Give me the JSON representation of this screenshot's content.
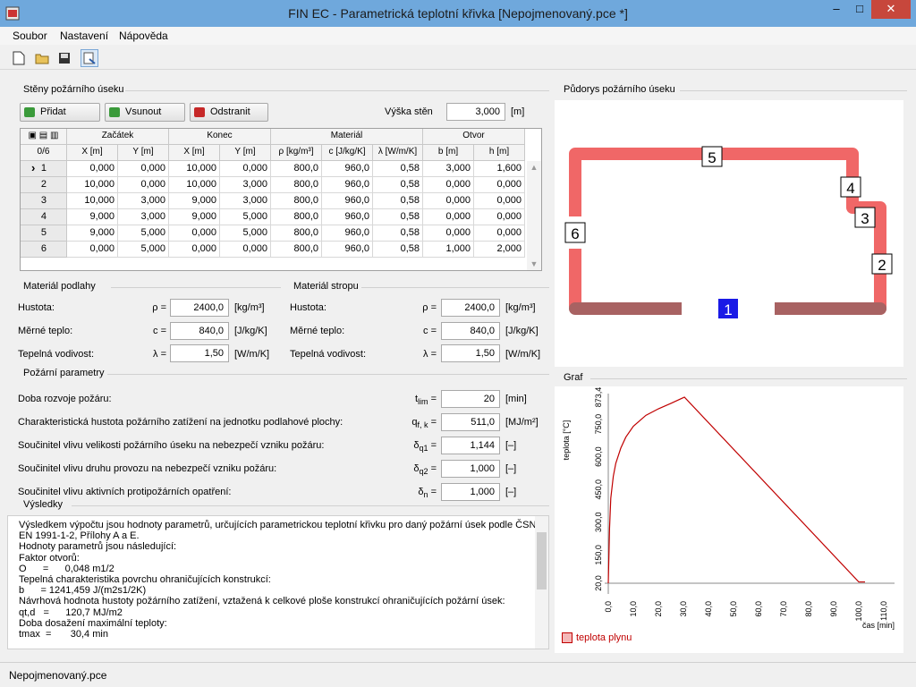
{
  "window": {
    "title": "FIN EC - Parametrická teplotní křivka [Nepojmenovaný.pce *]"
  },
  "menu": [
    "Soubor",
    "Nastavení",
    "Nápověda"
  ],
  "toolbar": {
    "icons": [
      "new-file-icon",
      "open-folder-icon",
      "save-icon",
      "report-icon"
    ]
  },
  "walls": {
    "title": "Stěny požárního úseku",
    "add": "Přidat",
    "insert": "Vsunout",
    "remove": "Odstranit",
    "height_label": "Výška stěn",
    "height_value": "3,000",
    "height_unit": "[m]",
    "count": "0/6",
    "groups": [
      "Začátek",
      "Konec",
      "Materiál",
      "Otvor"
    ],
    "columns": [
      "X [m]",
      "Y [m]",
      "X [m]",
      "Y [m]",
      "ρ [kg/m³]",
      "c [J/kg/K]",
      "λ [W/m/K]",
      "b [m]",
      "h [m]"
    ],
    "rows": [
      {
        "n": "1",
        "v": [
          "0,000",
          "0,000",
          "10,000",
          "0,000",
          "800,0",
          "960,0",
          "0,58",
          "3,000",
          "1,600"
        ]
      },
      {
        "n": "2",
        "v": [
          "10,000",
          "0,000",
          "10,000",
          "3,000",
          "800,0",
          "960,0",
          "0,58",
          "0,000",
          "0,000"
        ]
      },
      {
        "n": "3",
        "v": [
          "10,000",
          "3,000",
          "9,000",
          "3,000",
          "800,0",
          "960,0",
          "0,58",
          "0,000",
          "0,000"
        ]
      },
      {
        "n": "4",
        "v": [
          "9,000",
          "3,000",
          "9,000",
          "5,000",
          "800,0",
          "960,0",
          "0,58",
          "0,000",
          "0,000"
        ]
      },
      {
        "n": "5",
        "v": [
          "9,000",
          "5,000",
          "0,000",
          "5,000",
          "800,0",
          "960,0",
          "0,58",
          "0,000",
          "0,000"
        ]
      },
      {
        "n": "6",
        "v": [
          "0,000",
          "5,000",
          "0,000",
          "0,000",
          "800,0",
          "960,0",
          "0,58",
          "1,000",
          "2,000"
        ]
      }
    ]
  },
  "floor": {
    "title": "Materiál podlahy",
    "density_label": "Hustota:",
    "density_sym": "ρ =",
    "density": "2400,0",
    "density_unit": "[kg/m³]",
    "heat_label": "Měrné teplo:",
    "heat_sym": "c =",
    "heat": "840,0",
    "heat_unit": "[J/kg/K]",
    "cond_label": "Tepelná vodivost:",
    "cond_sym": "λ =",
    "cond": "1,50",
    "cond_unit": "[W/m/K]"
  },
  "ceiling": {
    "title": "Materiál stropu",
    "density_label": "Hustota:",
    "density_sym": "ρ =",
    "density": "2400,0",
    "density_unit": "[kg/m³]",
    "heat_label": "Měrné teplo:",
    "heat_sym": "c =",
    "heat": "840,0",
    "heat_unit": "[J/kg/K]",
    "cond_label": "Tepelná vodivost:",
    "cond_sym": "λ =",
    "cond": "1,50",
    "cond_unit": "[W/m/K]"
  },
  "fire": {
    "title": "Požární parametry",
    "params": [
      {
        "label": "Doba rozvoje požáru:",
        "sym": "t",
        "sub": "lim",
        "value": "20",
        "unit": "[min]"
      },
      {
        "label": "Charakteristická hustota požárního zatížení na jednotku podlahové plochy:",
        "sym": "q",
        "sub": "f, k",
        "value": "511,0",
        "unit": "[MJ/m²]"
      },
      {
        "label": "Součinitel vlivu velikosti požárního úseku na nebezpečí vzniku požáru:",
        "sym": "δ",
        "sub": "q1",
        "value": "1,144",
        "unit": "[–]"
      },
      {
        "label": "Součinitel vlivu druhu provozu na nebezpečí vzniku požáru:",
        "sym": "δ",
        "sub": "q2",
        "value": "1,000",
        "unit": "[–]"
      },
      {
        "label": "Součinitel vlivu aktivních protipožárních opatření:",
        "sym": "δ",
        "sub": "n",
        "value": "1,000",
        "unit": "[–]"
      }
    ]
  },
  "results": {
    "title": "Výsledky",
    "lines": [
      "Výsledkem výpočtu jsou hodnoty parametrů, určujících parametrickou teplotní křivku pro daný požární úsek podle ČSN",
      "EN 1991-1-2, Přílohy A a E.",
      "Hodnoty parametrů jsou následující:",
      "Faktor otvorů:",
      "O      =      0,048 m1/2",
      "Tepelná charakteristika povrchu ohraničujících konstrukcí:",
      "b      = 1241,459 J/(m2s1/2K)",
      "Návrhová hodnota hustoty požárního zatížení, vztažená k celkové ploše konstrukcí ohraničujících požární úsek:",
      "qt,d   =      120,7 MJ/m2",
      "Doba dosažení maximální teploty:",
      "tmax  =       30,4 min"
    ]
  },
  "plan": {
    "title": "Půdorys požárního úseku",
    "labels": [
      "1",
      "2",
      "3",
      "4",
      "5",
      "6"
    ]
  },
  "graph": {
    "title": "Graf",
    "legend": "teplota plynu"
  },
  "status": {
    "text": "Nepojmenovaný.pce"
  },
  "chart_data": {
    "type": "line",
    "xlabel": "čas [min]",
    "ylabel": "teplota [°C]",
    "xlim": [
      0,
      110
    ],
    "ylim": [
      20,
      873.4
    ],
    "x_ticks": [
      "0,0",
      "10,0",
      "20,0",
      "30,0",
      "40,0",
      "50,0",
      "60,0",
      "70,0",
      "80,0",
      "90,0",
      "100,0",
      "110,0"
    ],
    "y_ticks": [
      "20,0",
      "150,0",
      "300,0",
      "450,0",
      "600,0",
      "750,0",
      "873,4"
    ],
    "series": [
      {
        "name": "teplota plynu",
        "color": "#c00000",
        "x": [
          0,
          0.5,
          1,
          2,
          3,
          5,
          7,
          10,
          15,
          20,
          25,
          30.4,
          100,
          102.5
        ],
        "y": [
          20,
          270,
          410,
          510,
          570,
          640,
          690,
          740,
          790,
          820,
          845,
          873.4,
          26,
          26
        ]
      }
    ]
  }
}
